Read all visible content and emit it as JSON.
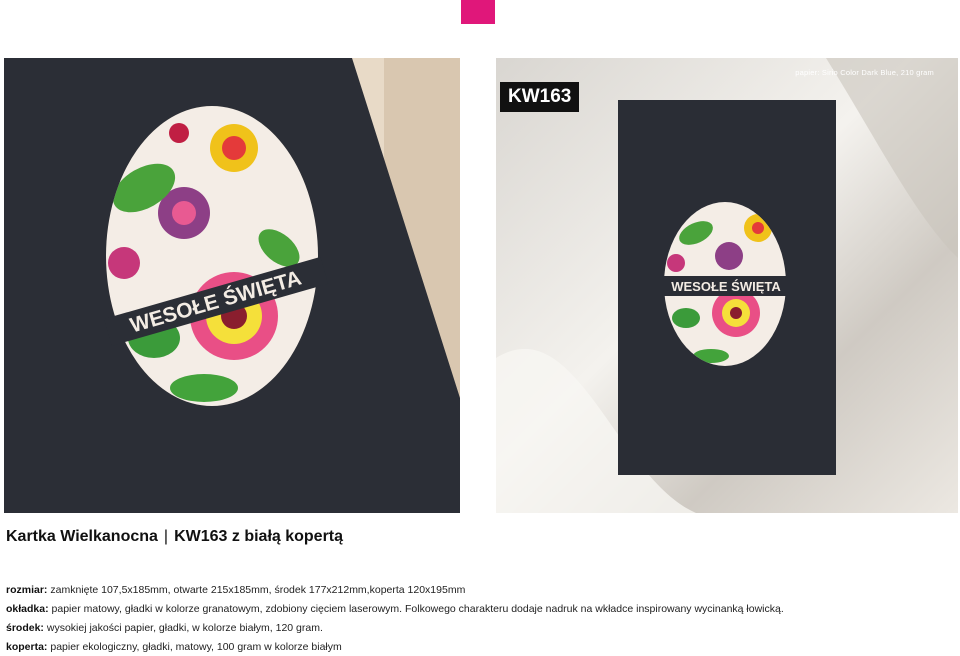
{
  "header": {
    "accent_color": "#e0177a"
  },
  "photos": {
    "left": {
      "card_text": "WESOŁE ŚWIĘTA"
    },
    "right": {
      "code_label": "KW163",
      "paper_note": "papier: Sirio Color Dark Blue, 210 gram",
      "card_text": "WESOŁE ŚWIĘTA"
    }
  },
  "product": {
    "title_name": "Kartka Wielkanocna",
    "title_separator": "|",
    "title_code": "KW163 z białą kopertą"
  },
  "specs": [
    {
      "label": "rozmiar:",
      "value": "zamknięte 107,5x185mm, otwarte 215x185mm, środek 177x212mm,koperta 120x195mm"
    },
    {
      "label": "okładka:",
      "value": "papier matowy, gładki w kolorze granatowym, zdobiony cięciem laserowym. Folkowego charakteru dodaje nadruk na wkładce inspirowany wycinanką łowicką."
    },
    {
      "label": "środek:",
      "value": "wysokiej jakości papier, gładki, w kolorze białym, 120 gram."
    },
    {
      "label": "koperta:",
      "value": "papier ekologiczny, gładki, matowy, 100 gram w kolorze białym"
    }
  ],
  "colors": {
    "card_navy": "#2a2d35",
    "cream": "#f3ece4"
  }
}
